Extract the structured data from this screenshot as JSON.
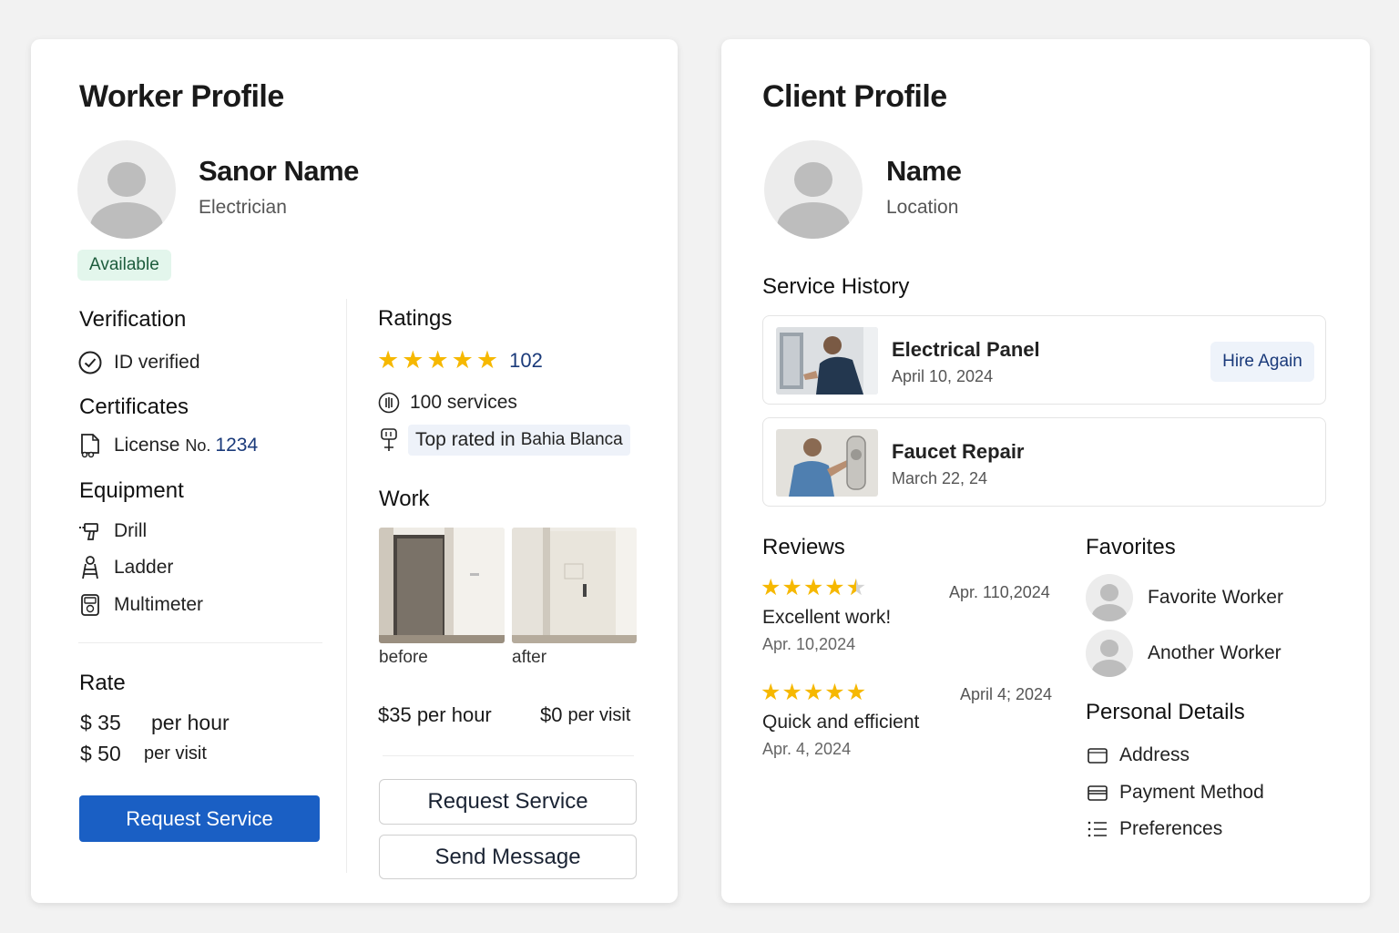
{
  "worker": {
    "title": "Worker Profile",
    "name": "Sanor Name",
    "role": "Electrician",
    "status": "Available",
    "verification": {
      "heading": "Verification",
      "item": "ID verified"
    },
    "certificates": {
      "heading": "Certificates",
      "prefix": "License",
      "no": "No.",
      "number": "1234"
    },
    "equipment": {
      "heading": "Equipment",
      "items": [
        "Drill",
        "Ladder",
        "Multimeter"
      ]
    },
    "rate": {
      "heading": "Rate",
      "hour_amount": "$ 35",
      "hour_unit": "per hour",
      "visit_amount": "$ 50",
      "visit_unit": "per visit"
    },
    "request_button": "Request Service",
    "ratings": {
      "heading": "Ratings",
      "stars": 5,
      "count": "102",
      "services": "100 services",
      "top_rated_prefix": "Top rated in",
      "top_rated_place": "Bahia Blanca"
    },
    "work": {
      "heading": "Work",
      "before_label": "before",
      "after_label": "after"
    },
    "pricing": {
      "hour": "$35 per hour",
      "visit_amount": "$0",
      "visit_unit": "per visit"
    },
    "request_button_outline": "Request Service",
    "message_button": "Send Message"
  },
  "client": {
    "title": "Client Profile",
    "name": "Name",
    "location": "Location",
    "history": {
      "heading": "Service History",
      "items": [
        {
          "title": "Electrical Panel",
          "date": "April 10, 2024",
          "action": "Hire Again"
        },
        {
          "title": "Faucet Repair",
          "date": "March 22, 24"
        }
      ]
    },
    "reviews": {
      "heading": "Reviews",
      "items": [
        {
          "stars": 4.5,
          "date": "Apr. 110,2024",
          "text": "Excellent work!",
          "sub_date": "Apr. 10,2024"
        },
        {
          "stars": 5,
          "date": "April 4; 2024",
          "text": "Quick and efficient",
          "sub_date": "Apr. 4, 2024"
        }
      ]
    },
    "favorites": {
      "heading": "Favorites",
      "items": [
        "Favorite Worker",
        "Another Worker"
      ]
    },
    "personal": {
      "heading": "Personal Details",
      "items": [
        "Address",
        "Payment Method",
        "Preferences"
      ]
    }
  },
  "colors": {
    "accent": "#1a5fc4",
    "star": "#f6b800",
    "available_bg": "#e3f6ec",
    "link": "#1a3a7a"
  }
}
